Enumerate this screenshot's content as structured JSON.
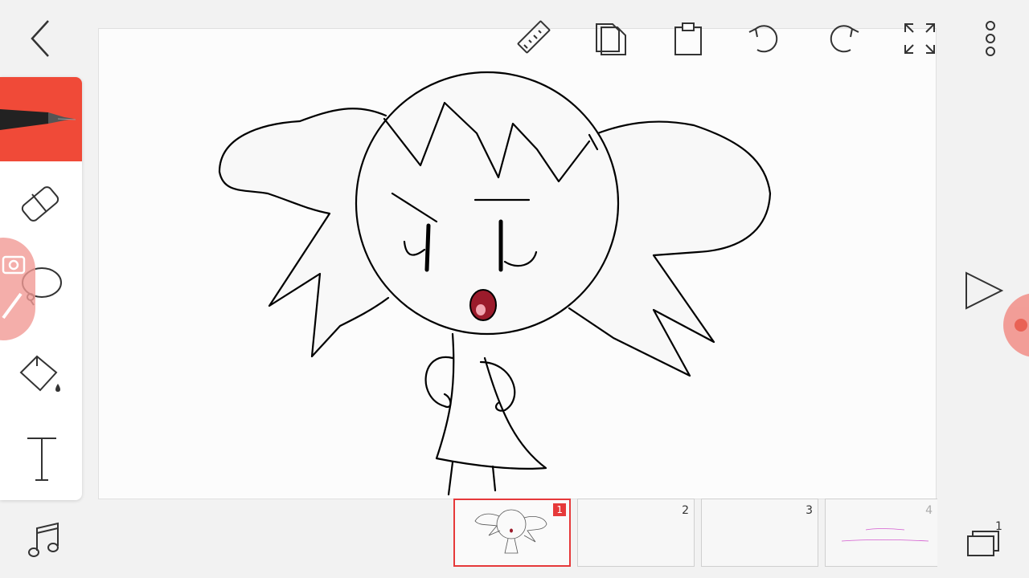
{
  "toolbar": {
    "icons": [
      "back-icon",
      "ruler-icon",
      "copy-icon",
      "paste-icon",
      "undo-icon",
      "redo-icon",
      "fullscreen-icon",
      "more-icon"
    ]
  },
  "tools": [
    "pen-icon",
    "eraser-icon",
    "lasso-icon",
    "fill-bucket-icon",
    "text-icon"
  ],
  "frames": [
    {
      "number": "1",
      "active": true
    },
    {
      "number": "2",
      "active": false
    },
    {
      "number": "3",
      "active": false
    },
    {
      "number": "4",
      "active": false
    }
  ],
  "layers": {
    "count": "1"
  },
  "colors": {
    "accent": "#f04a38",
    "fab": "#f28f88",
    "ink": "#000000",
    "mouth": "#9b1b2b"
  }
}
